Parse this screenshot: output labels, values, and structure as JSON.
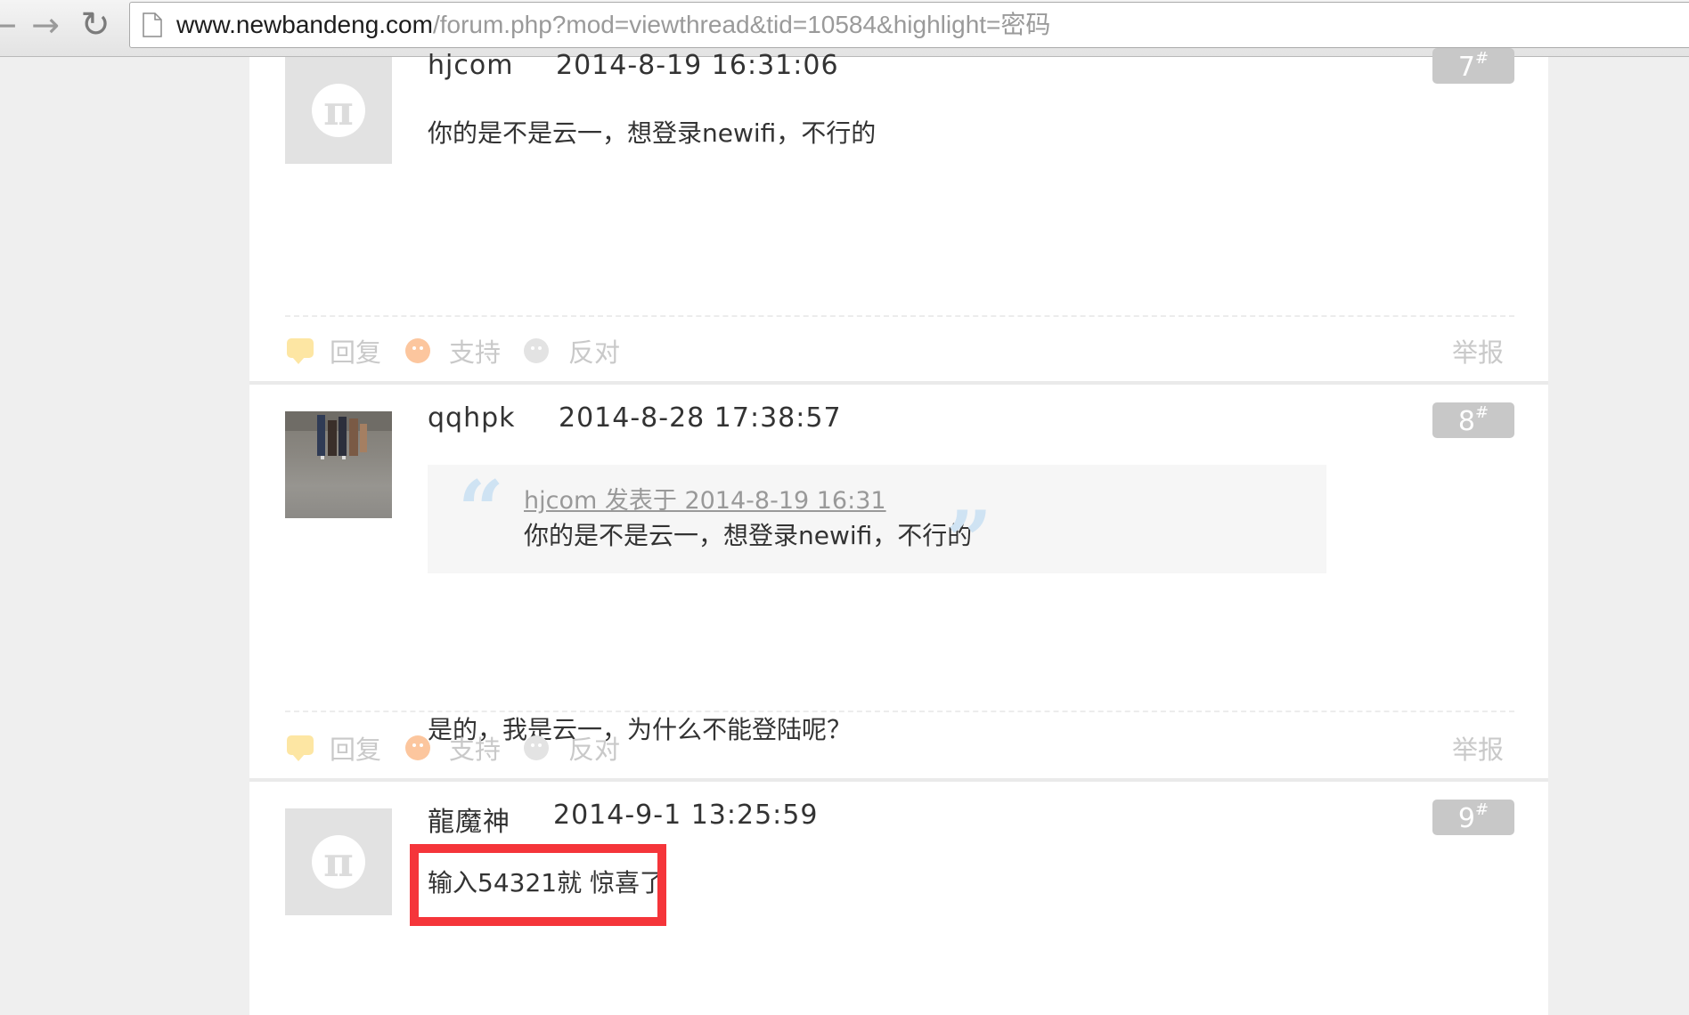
{
  "browser": {
    "back_icon": "arrow-left-icon",
    "forward_icon": "arrow-right-icon",
    "reload_icon": "reload-icon",
    "url_host": "www.newbandeng.com",
    "url_path": "/forum.php?mod=viewthread&tid=10584&highlight=密码"
  },
  "posts": [
    {
      "author": "hjcom",
      "time": "2014-8-19 16:31:06",
      "floor": "7",
      "floor_sup": "#",
      "message": "你的是不是云一，想登录newifi，不行的",
      "avatar": "default-avatar"
    },
    {
      "author": "qqhpk",
      "time": "2014-8-28 17:38:57",
      "floor": "8",
      "floor_sup": "#",
      "quote_source": "hjcom 发表于 2014-8-19 16:31",
      "quote_text": "你的是不是云一，想登录newifi，不行的",
      "message": "是的，我是云一，为什么不能登陆呢？",
      "avatar": "photo-avatar"
    },
    {
      "author": "龍魔神",
      "time": "2014-9-1 13:25:59",
      "floor": "9",
      "floor_sup": "#",
      "message": "输入54321就 惊喜了",
      "avatar": "default-avatar"
    }
  ],
  "actions": {
    "reply": "回复",
    "support": "支持",
    "oppose": "反对",
    "report": "举报"
  },
  "colors": {
    "highlight": "#f5353a",
    "floor_badge": "#c8c8c8"
  }
}
